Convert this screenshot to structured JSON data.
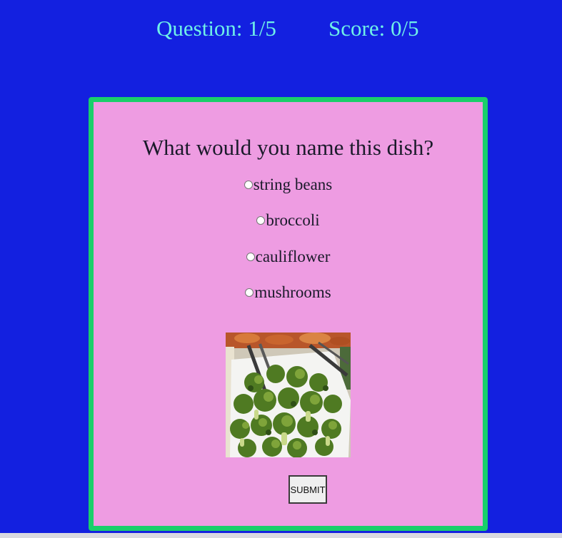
{
  "header": {
    "question_label": "Question: 1/5",
    "score_label": "Score: 0/5"
  },
  "quiz": {
    "question": "What would you name this dish?",
    "options": [
      {
        "label": "string beans",
        "selected": false
      },
      {
        "label": "broccoli",
        "selected": false
      },
      {
        "label": "cauliflower",
        "selected": false
      },
      {
        "label": "mushrooms",
        "selected": false
      }
    ],
    "image_icon": "broccoli-dish-photo",
    "submit_label": "SUBMIT"
  },
  "colors": {
    "page_background": "#1320e0",
    "header_text": "#6ff0e8",
    "card_background": "#ee9ce2",
    "card_border": "#19cf6a"
  }
}
